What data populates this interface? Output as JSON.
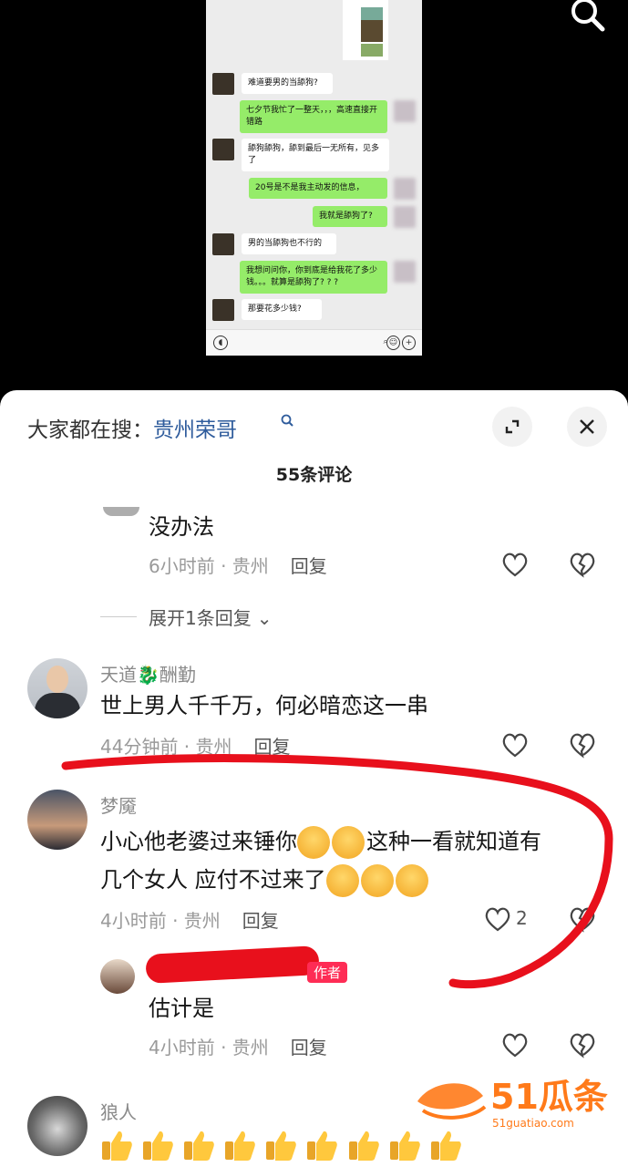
{
  "video": {
    "chat": [
      {
        "side": "in",
        "text": "难道要男的当舔狗?"
      },
      {
        "side": "out",
        "text": "七夕节我忙了一整天，，，高速直接开错路"
      },
      {
        "side": "in",
        "text": "舔狗舔狗，舔到最后一无所有，见多了"
      },
      {
        "side": "out",
        "text": "20号是不是我主动发的信息，"
      },
      {
        "side": "out",
        "text": "我就是舔狗了?"
      },
      {
        "side": "in",
        "text": "男的当舔狗也不行的"
      },
      {
        "side": "out",
        "text": "我想问问你，你到底是给我花了多少钱。。。就算是舔狗了? ? ?"
      },
      {
        "side": "in",
        "text": "那要花多少钱?"
      }
    ]
  },
  "panel": {
    "trending_label": "大家都在搜：",
    "trending_query": "贵州荣哥",
    "comment_count": "55条评论"
  },
  "comments": {
    "c0": {
      "text": "没办法",
      "time": "6小时前 · 贵州",
      "reply": "回复",
      "expand": "展开1条回复"
    },
    "c1": {
      "name": "天道🐉酬勤",
      "text": "世上男人千千万，何必暗恋这一串",
      "time": "44分钟前 · 贵州",
      "reply": "回复"
    },
    "c2": {
      "name": "梦魇",
      "text_a": "小心他老婆过来锤你",
      "text_b": "这种一看就知道有",
      "text_c": "几个女人  应付不过来了",
      "time": "4小时前 · 贵州",
      "reply": "回复",
      "likes": "2"
    },
    "c3": {
      "author_badge": "作者",
      "text": "估计是",
      "time": "4小时前 · 贵州",
      "reply": "回复"
    },
    "c4": {
      "name": "狼人"
    }
  },
  "colors": {
    "accent": "#fe2c55",
    "link": "#2f5c9c",
    "wechat_green": "#95ec69",
    "annotation": "#e8101c"
  },
  "watermark": {
    "text": "51瓜条",
    "sub": "51guatiao.com"
  }
}
